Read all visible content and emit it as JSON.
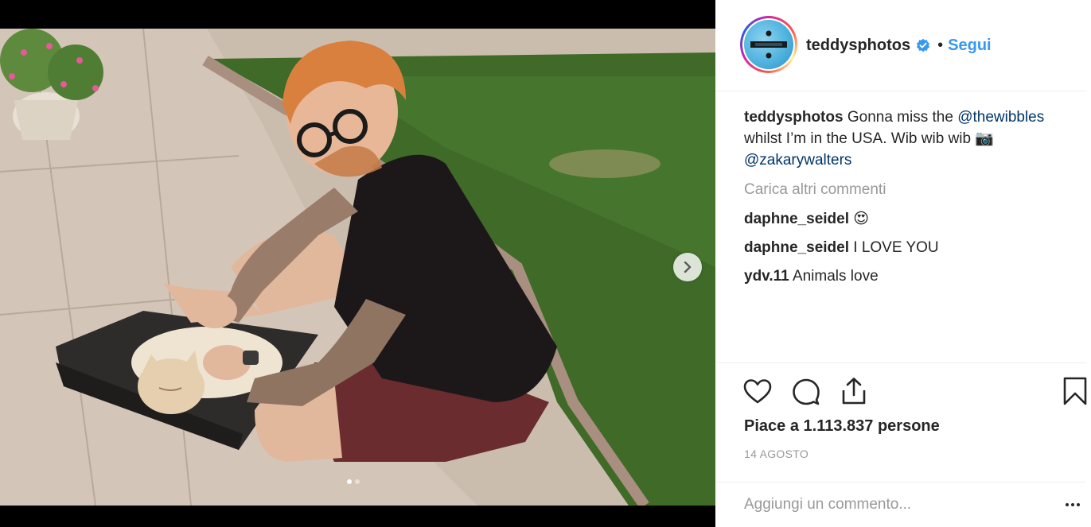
{
  "post": {
    "photo_alt": "Photo by teddysphotos",
    "carousel": {
      "total": 2,
      "active": 1
    }
  },
  "header": {
    "username": "teddysphotos",
    "separator": "•",
    "follow_label": "Segui"
  },
  "caption": {
    "username": "teddysphotos",
    "text_before": "Gonna miss the ",
    "mention1": "@thewibbles",
    "text_after": " whilst I’m in the USA. Wib wib wib 📷 ",
    "mention2": "@zakarywalters"
  },
  "load_more_label": "Carica altri commenti",
  "comments": [
    {
      "username": "daphne_seidel",
      "text": "😍"
    },
    {
      "username": "daphne_seidel",
      "text": "I LOVE YOU"
    },
    {
      "username": "ydv.11",
      "text": "Animals love"
    }
  ],
  "likes": {
    "prefix": "Piace a ",
    "count": "1.113.837",
    "suffix": " persone"
  },
  "date": "14 AGOSTO",
  "add_comment": {
    "placeholder": "Aggiungi un commento..."
  },
  "icons": {
    "like": "heart-icon",
    "comment": "comment-bubble-icon",
    "share": "share-icon",
    "save": "bookmark-icon",
    "next": "chevron-right-icon",
    "verified": "verified-badge-icon",
    "more": "more-options-icon"
  },
  "colors": {
    "accent": "#3897f0",
    "mention": "#003569",
    "muted": "#999999",
    "text": "#262626"
  }
}
